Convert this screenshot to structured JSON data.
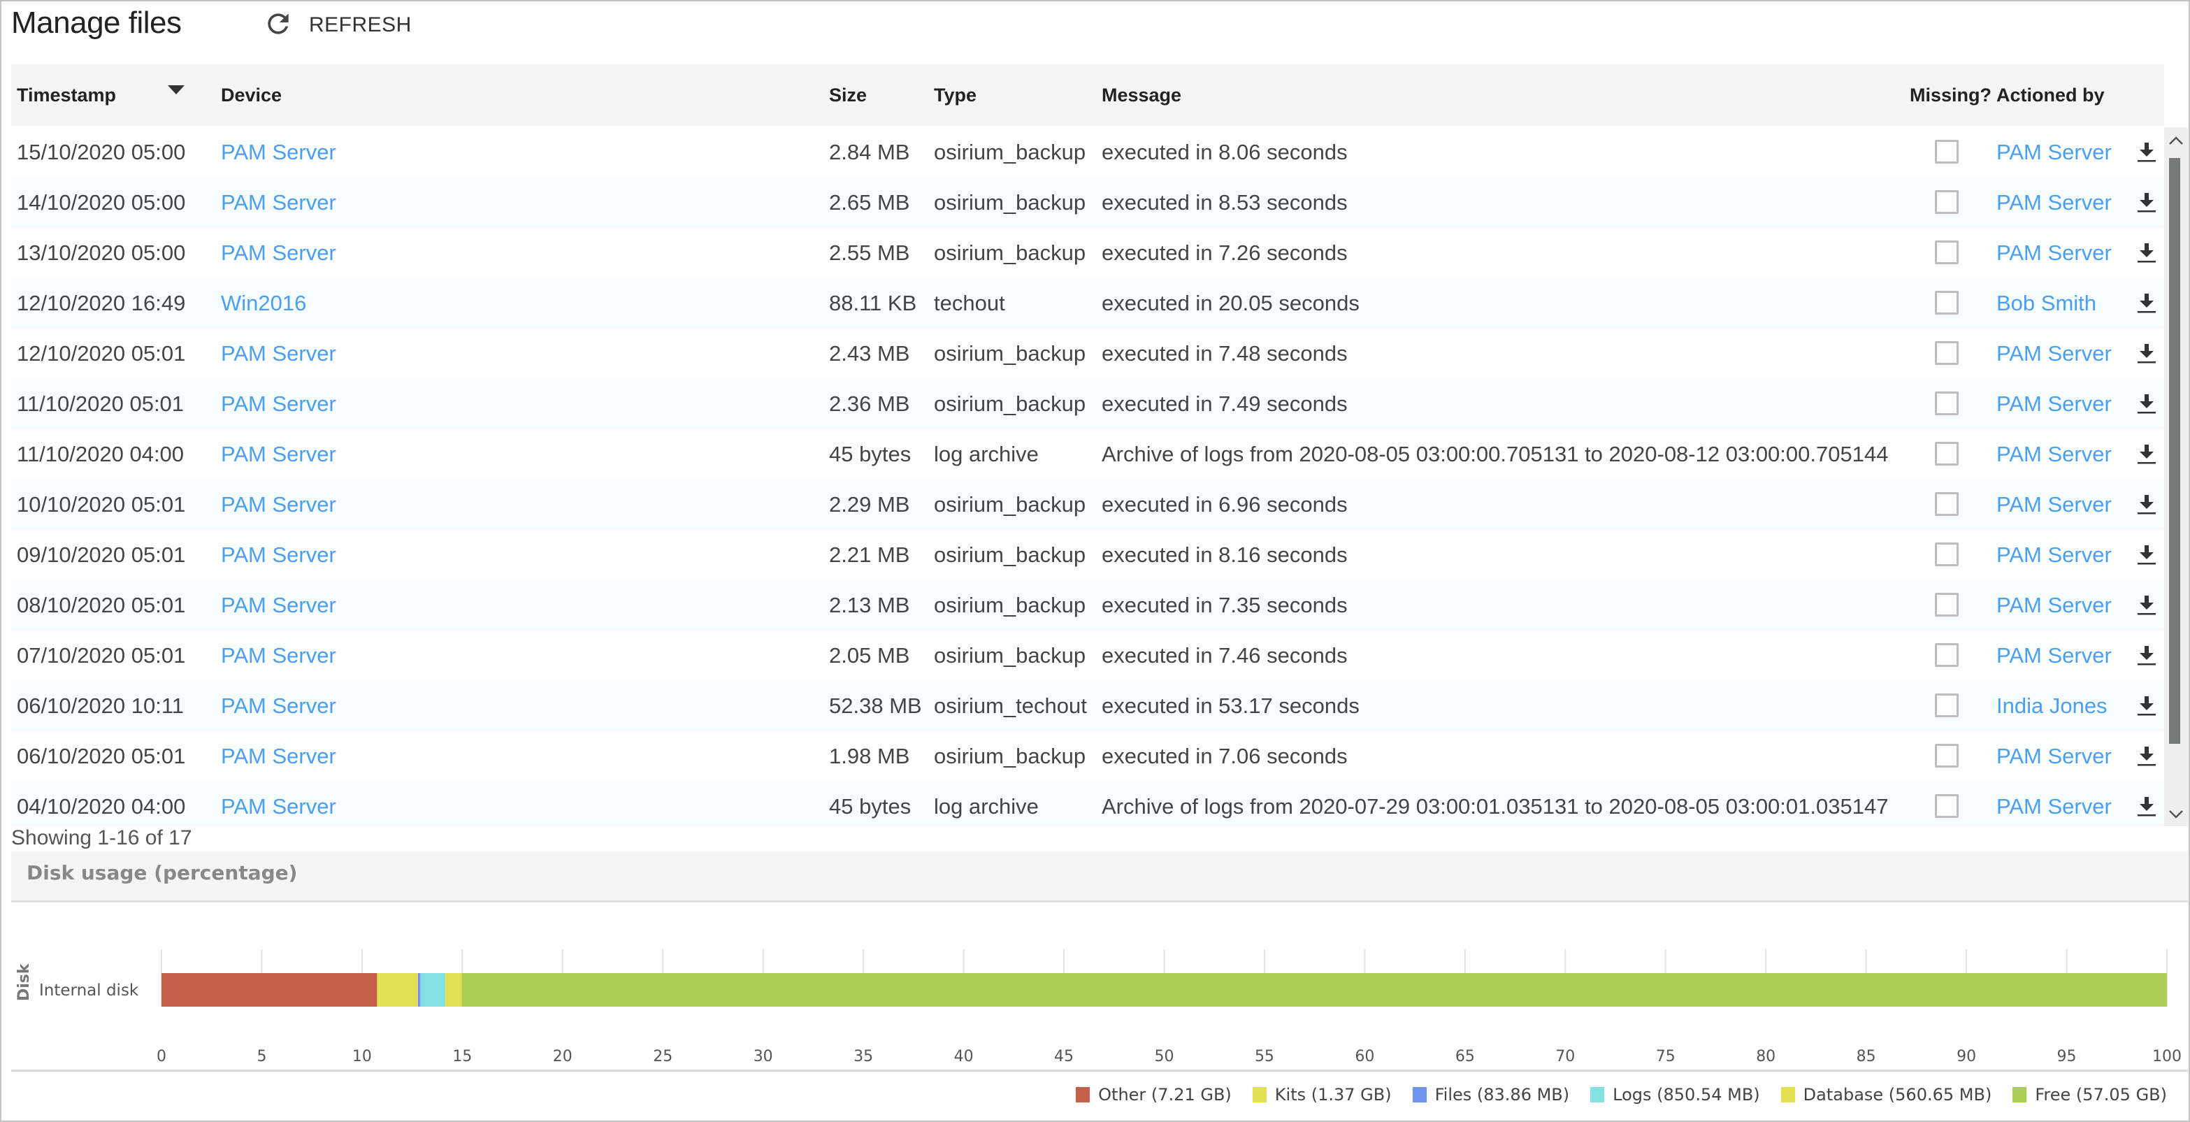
{
  "header": {
    "title": "Manage files",
    "refresh_label": "REFRESH",
    "refresh_icon": "refresh-icon"
  },
  "table": {
    "columns": {
      "timestamp": "Timestamp",
      "device": "Device",
      "size": "Size",
      "type": "Type",
      "message": "Message",
      "missing": "Missing?",
      "actioned_by": "Actioned by"
    },
    "sort": {
      "column": "Timestamp",
      "direction": "descending",
      "icon": "sort-desc-icon"
    },
    "rows": [
      {
        "timestamp": "15/10/2020 05:00",
        "device": "PAM Server",
        "size": "2.84 MB",
        "type": "osirium_backup",
        "message": "executed in 8.06 seconds",
        "missing": false,
        "actioned_by": "PAM Server"
      },
      {
        "timestamp": "14/10/2020 05:00",
        "device": "PAM Server",
        "size": "2.65 MB",
        "type": "osirium_backup",
        "message": "executed in 8.53 seconds",
        "missing": false,
        "actioned_by": "PAM Server"
      },
      {
        "timestamp": "13/10/2020 05:00",
        "device": "PAM Server",
        "size": "2.55 MB",
        "type": "osirium_backup",
        "message": "executed in 7.26 seconds",
        "missing": false,
        "actioned_by": "PAM Server"
      },
      {
        "timestamp": "12/10/2020 16:49",
        "device": "Win2016",
        "size": "88.11 KB",
        "type": "techout",
        "message": "executed in 20.05 seconds",
        "missing": false,
        "actioned_by": "Bob Smith"
      },
      {
        "timestamp": "12/10/2020 05:01",
        "device": "PAM Server",
        "size": "2.43 MB",
        "type": "osirium_backup",
        "message": "executed in 7.48 seconds",
        "missing": false,
        "actioned_by": "PAM Server"
      },
      {
        "timestamp": "11/10/2020 05:01",
        "device": "PAM Server",
        "size": "2.36 MB",
        "type": "osirium_backup",
        "message": "executed in 7.49 seconds",
        "missing": false,
        "actioned_by": "PAM Server"
      },
      {
        "timestamp": "11/10/2020 04:00",
        "device": "PAM Server",
        "size": "45 bytes",
        "type": "log archive",
        "message": "Archive of logs from 2020-08-05 03:00:00.705131 to 2020-08-12 03:00:00.705144",
        "missing": false,
        "actioned_by": "PAM Server"
      },
      {
        "timestamp": "10/10/2020 05:01",
        "device": "PAM Server",
        "size": "2.29 MB",
        "type": "osirium_backup",
        "message": "executed in 6.96 seconds",
        "missing": false,
        "actioned_by": "PAM Server"
      },
      {
        "timestamp": "09/10/2020 05:01",
        "device": "PAM Server",
        "size": "2.21 MB",
        "type": "osirium_backup",
        "message": "executed in 8.16 seconds",
        "missing": false,
        "actioned_by": "PAM Server"
      },
      {
        "timestamp": "08/10/2020 05:01",
        "device": "PAM Server",
        "size": "2.13 MB",
        "type": "osirium_backup",
        "message": "executed in 7.35 seconds",
        "missing": false,
        "actioned_by": "PAM Server"
      },
      {
        "timestamp": "07/10/2020 05:01",
        "device": "PAM Server",
        "size": "2.05 MB",
        "type": "osirium_backup",
        "message": "executed in 7.46 seconds",
        "missing": false,
        "actioned_by": "PAM Server"
      },
      {
        "timestamp": "06/10/2020 10:11",
        "device": "PAM Server",
        "size": "52.38 MB",
        "type": "osirium_techout",
        "message": "executed in 53.17 seconds",
        "missing": false,
        "actioned_by": "India Jones"
      },
      {
        "timestamp": "06/10/2020 05:01",
        "device": "PAM Server",
        "size": "1.98 MB",
        "type": "osirium_backup",
        "message": "executed in 7.06 seconds",
        "missing": false,
        "actioned_by": "PAM Server"
      },
      {
        "timestamp": "04/10/2020 04:00",
        "device": "PAM Server",
        "size": "45 bytes",
        "type": "log archive",
        "message": "Archive of logs from 2020-07-29 03:00:01.035131 to 2020-08-05 03:00:01.035147",
        "missing": false,
        "actioned_by": "PAM Server"
      }
    ],
    "row_action_icon": "download-icon",
    "pagination_text": "Showing 1-16 of 17"
  },
  "colors": {
    "link": "#4a9ff5",
    "row_alt": "#f7fdff",
    "header_bg": "#f5f5f5"
  },
  "disk_panel": {
    "title": "Disk usage (percentage)"
  },
  "chart_data": {
    "type": "bar",
    "orientation": "horizontal",
    "stacked": true,
    "title": "Disk usage (percentage)",
    "ylabel": "Disk",
    "xlabel": "",
    "categories": [
      "Internal disk"
    ],
    "xlim": [
      0,
      100
    ],
    "xticks": [
      0,
      5,
      10,
      15,
      20,
      25,
      30,
      35,
      40,
      45,
      50,
      55,
      60,
      65,
      70,
      75,
      80,
      85,
      90,
      95,
      100
    ],
    "grid": true,
    "legend_position": "bottom-right",
    "series": [
      {
        "name": "Other",
        "legend_label": "Other (7.21 GB)",
        "color": "#c4604a",
        "values": [
          10.75
        ]
      },
      {
        "name": "Kits",
        "legend_label": "Kits (1.37 GB)",
        "color": "#e3e152",
        "values": [
          2.04
        ]
      },
      {
        "name": "Files",
        "legend_label": "Files (83.86 MB)",
        "color": "#6f94f0",
        "values": [
          0.12
        ]
      },
      {
        "name": "Logs",
        "legend_label": "Logs (850.54 MB)",
        "color": "#84e1e3",
        "values": [
          1.24
        ]
      },
      {
        "name": "Database",
        "legend_label": "Database (560.65 MB)",
        "color": "#e3e152",
        "values": [
          0.82
        ]
      },
      {
        "name": "Free",
        "legend_label": "Free (57.05 GB)",
        "color": "#abcf52",
        "values": [
          85.03
        ]
      }
    ]
  }
}
